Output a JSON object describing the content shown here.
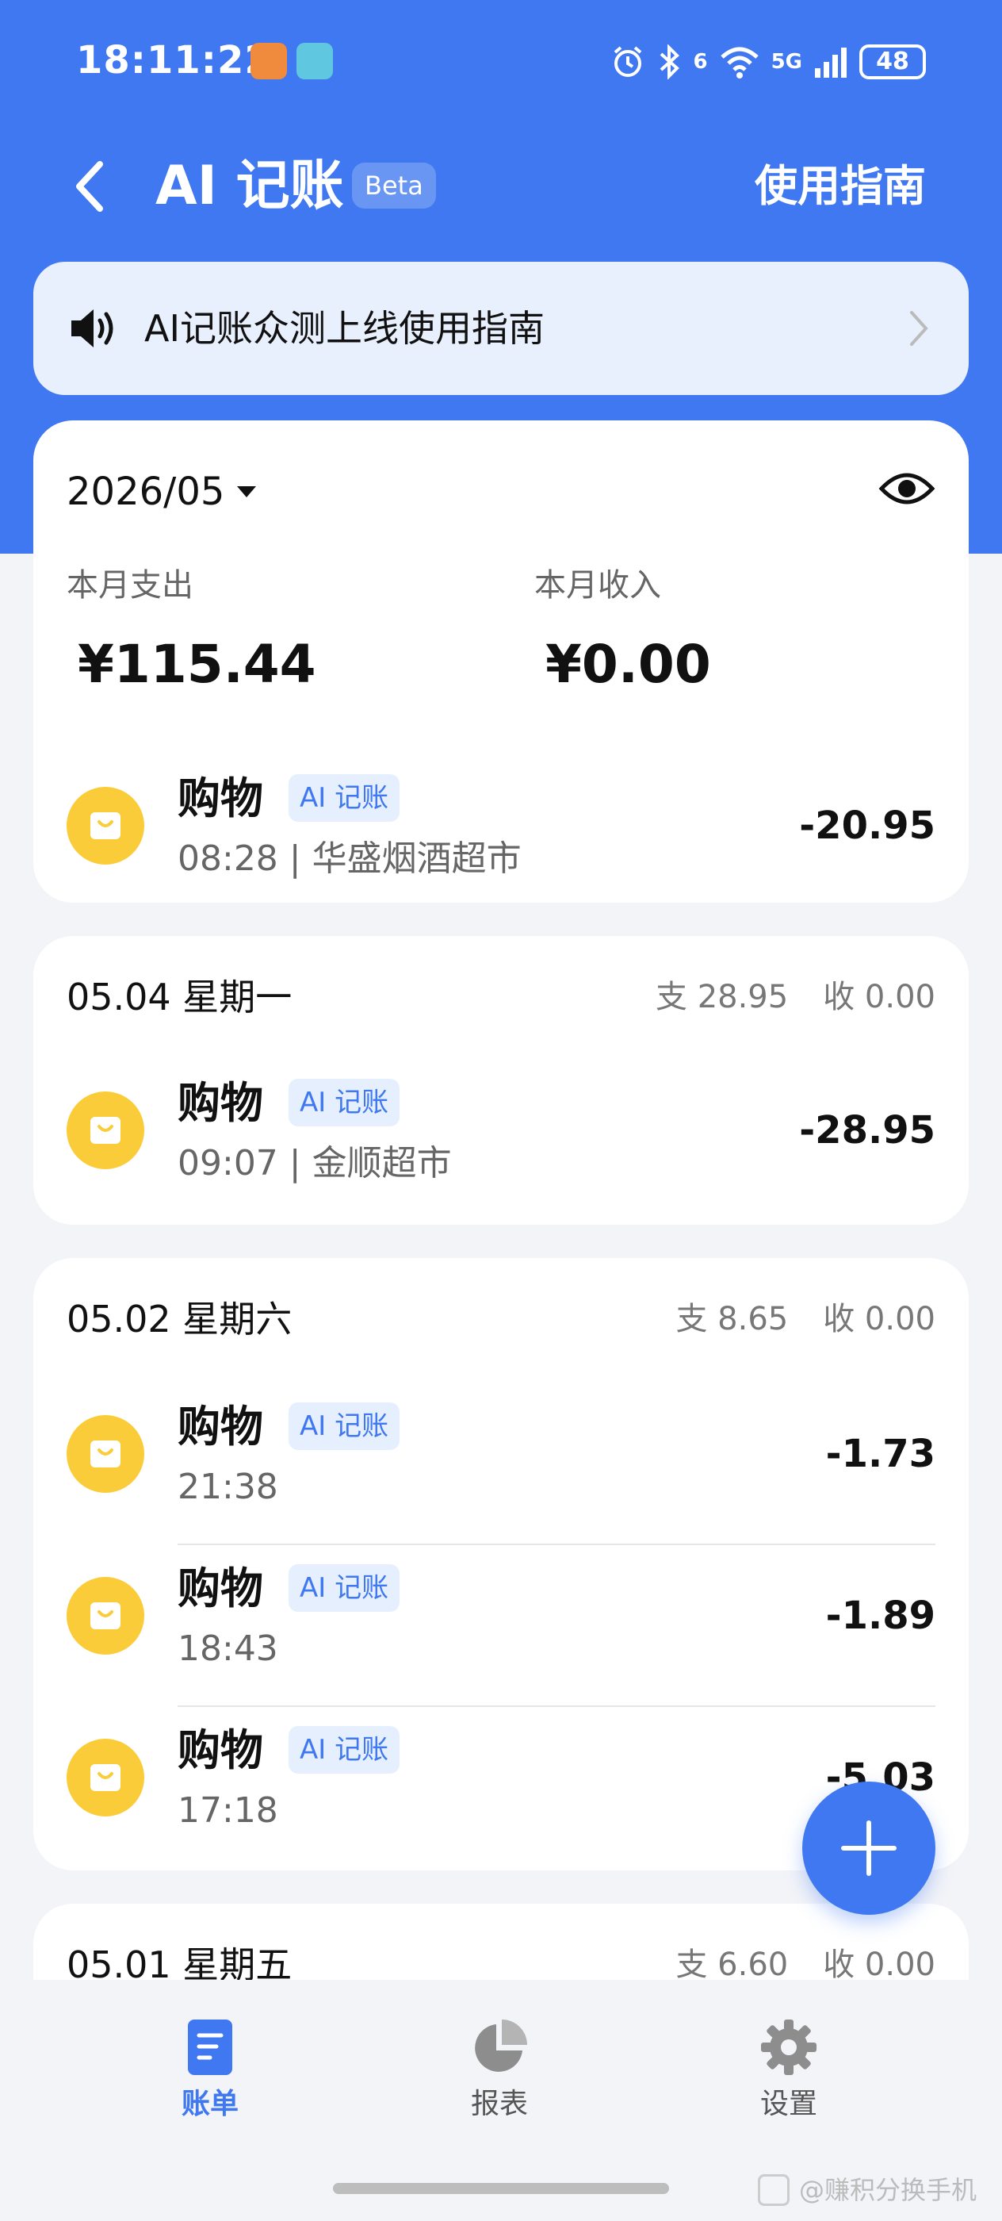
{
  "status_bar": {
    "time": "18:11:22",
    "network": "5G",
    "wifi_badge": "6",
    "battery": "48",
    "icons": [
      "alarm-icon",
      "bluetooth-icon",
      "wifi-icon",
      "signal-icon"
    ]
  },
  "header": {
    "title": "AI 记账",
    "badge": "Beta",
    "guide_link": "使用指南"
  },
  "notice": {
    "text": "AI记账众测上线使用指南"
  },
  "summary": {
    "month": "2026/05",
    "expense_label": "本月支出",
    "expense_value": "¥115.44",
    "income_label": "本月收入",
    "income_value": "¥0.00"
  },
  "today_tx": {
    "category": "购物",
    "badge": "AI 记账",
    "subtitle": "08:28 | 华盛烟酒超市",
    "amount": "-20.95"
  },
  "days": [
    {
      "date": "05.04 星期一",
      "expense": "支 28.95",
      "income": "收 0.00",
      "transactions": [
        {
          "category": "购物",
          "badge": "AI 记账",
          "subtitle": "09:07 | 金顺超市",
          "amount": "-28.95"
        }
      ]
    },
    {
      "date": "05.02 星期六",
      "expense": "支 8.65",
      "income": "收 0.00",
      "transactions": [
        {
          "category": "购物",
          "badge": "AI 记账",
          "subtitle": "21:38",
          "amount": "-1.73"
        },
        {
          "category": "购物",
          "badge": "AI 记账",
          "subtitle": "18:43",
          "amount": "-1.89"
        },
        {
          "category": "购物",
          "badge": "AI 记账",
          "subtitle": "17:18",
          "amount": "-5.03"
        }
      ]
    },
    {
      "date": "05.01 星期五",
      "expense": "支 6.60",
      "income": "收 0.00",
      "transactions": []
    }
  ],
  "bottom_nav": [
    {
      "label": "账单",
      "icon": "bill-icon",
      "active": true
    },
    {
      "label": "报表",
      "icon": "pie-chart-icon",
      "active": false
    },
    {
      "label": "设置",
      "icon": "gear-icon",
      "active": false
    }
  ],
  "watermark": "@赚积分换手机",
  "colors": {
    "primary": "#3f78f0",
    "category_icon": "#fbcc3a",
    "background": "#f3f4f8"
  }
}
